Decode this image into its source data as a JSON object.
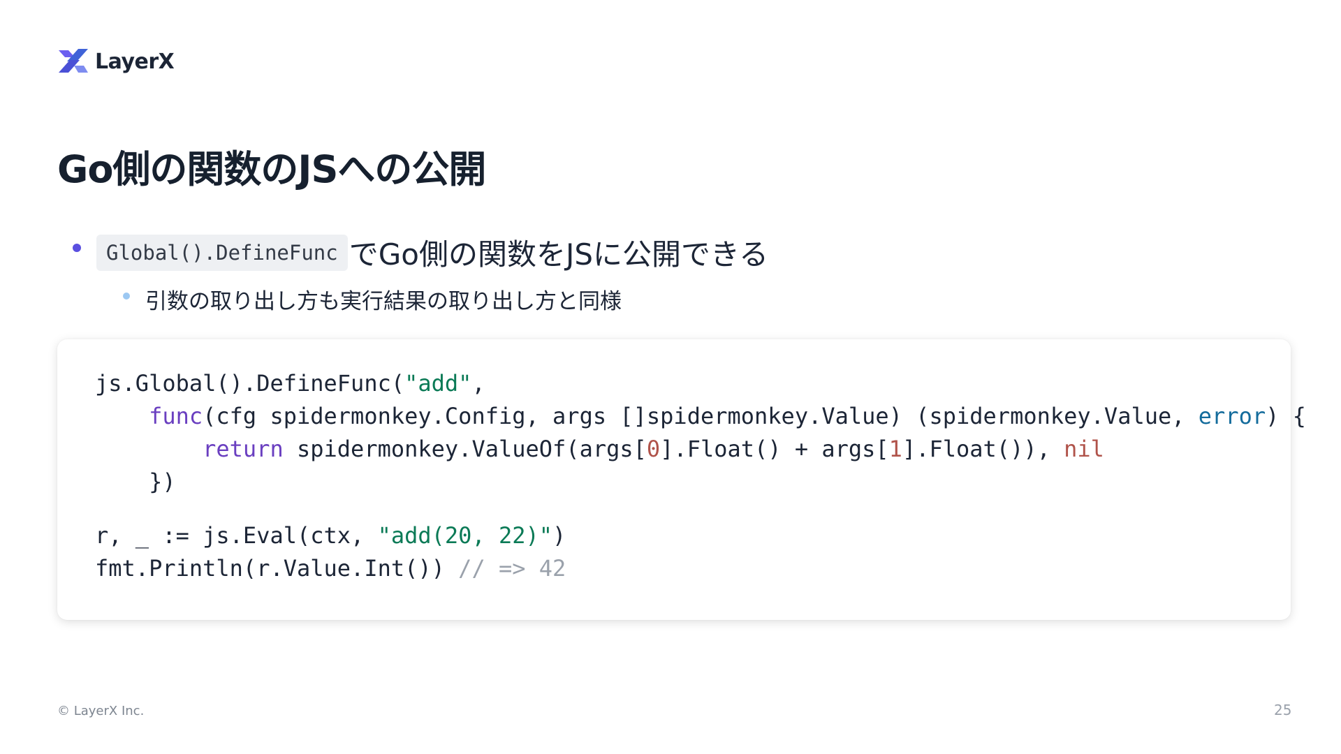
{
  "brand": {
    "name": "LayerX",
    "logo_icon": "layerx-logo-icon",
    "logo_color": "#5a4fe0"
  },
  "slide": {
    "title": "Go側の関数のJSへの公開",
    "bullets": [
      {
        "code": "Global().DefineFunc",
        "text": "でGo側の関数をJSに公開できる"
      }
    ],
    "sub_bullets": [
      {
        "text": "引数の取り出し方も実行結果の取り出し方と同様"
      }
    ],
    "code_block": {
      "l1": {
        "a": "js.Global().DefineFunc(",
        "s": "\"add\"",
        "b": ","
      },
      "l2": {
        "indent": "    ",
        "kw": "func",
        "a": "(cfg spidermonkey.Config, args []spidermonkey.Value) (spidermonkey.Value, ",
        "typ": "error",
        "b": ") {"
      },
      "l3": {
        "indent": "        ",
        "kw": "return",
        "a": " spidermonkey.ValueOf(args[",
        "n1": "0",
        "b": "].Float() + args[",
        "n2": "1",
        "c": "].Float()), ",
        "lit": "nil"
      },
      "l4": {
        "indent": "    ",
        "a": "})"
      },
      "l5": {
        "a": "r, _ := js.Eval(ctx, ",
        "s": "\"add(20, 22)\"",
        "b": ")"
      },
      "l6": {
        "a": "fmt.Println(r.Value.Int()) ",
        "cmt": "// => 42"
      }
    },
    "footer": {
      "copyright": "© LayerX Inc.",
      "page_number": "25"
    }
  }
}
